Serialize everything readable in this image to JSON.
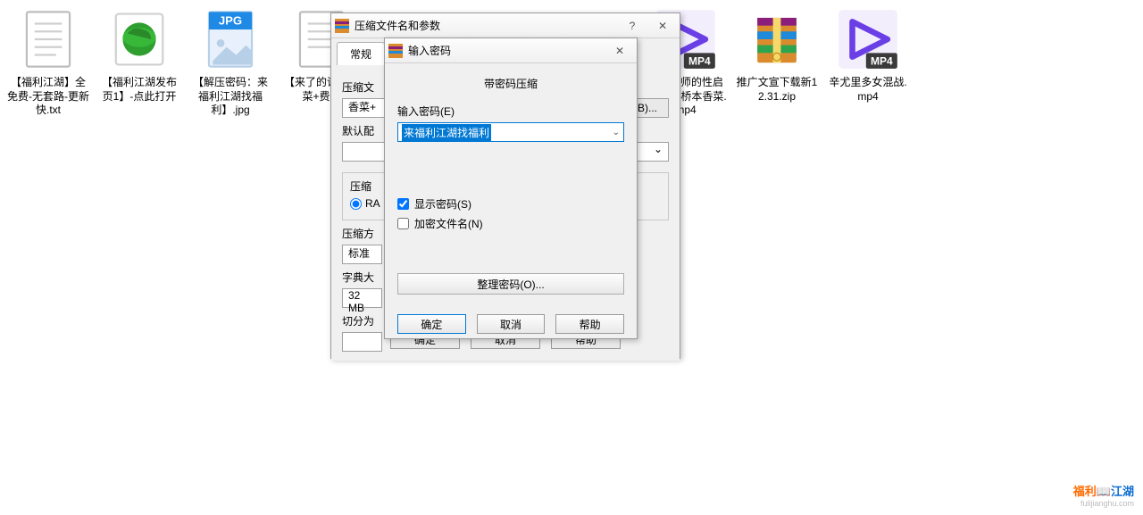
{
  "files": [
    {
      "name": "【福利江湖】全免费-无套路-更新快.txt",
      "type": "txt"
    },
    {
      "name": "【福利江湖发布页1】-点此打开",
      "type": "web"
    },
    {
      "name": "【解压密码：来福利江湖找福利】.jpg",
      "type": "jpg"
    },
    {
      "name": "【来了的论坛香菜+费！",
      "type": "txt"
    },
    {
      "name": "",
      "type": "blank"
    },
    {
      "name": "",
      "type": "blank"
    },
    {
      "name": "",
      "type": "blank"
    },
    {
      "name": "家教老师的性启性教育-桥本香菜.mp4",
      "type": "mp4"
    },
    {
      "name": "推广文宣下载新12.31.zip",
      "type": "zip"
    },
    {
      "name": "辛尤里多女混战.mp4",
      "type": "mp4"
    }
  ],
  "dialog_outer": {
    "title": "压缩文件名和参数",
    "tab_general": "常规",
    "lbl_archive_name": "压缩文",
    "archive_value": "香菜+",
    "browse": "(B)...",
    "lbl_default": "默认配",
    "group_format": "压缩",
    "radio_rar": "RA",
    "lbl_method": "压缩方",
    "method_value": "标准",
    "lbl_dict": "字典大",
    "dict_value": "32 MB",
    "lbl_split": "切分为",
    "btn_ok": "确定",
    "btn_cancel": "取消",
    "btn_help": "帮助"
  },
  "dialog_inner": {
    "title": "输入密码",
    "heading": "带密码压缩",
    "lbl_enter": "输入密码(E)",
    "password_value": "来福利江湖找福利",
    "cb_show": "显示密码(S)",
    "cb_encrypt": "加密文件名(N)",
    "btn_organize": "整理密码(O)...",
    "btn_ok": "确定",
    "btn_cancel": "取消",
    "btn_help": "帮助"
  },
  "watermark": {
    "line1a": "福利",
    "line1b": "江湖",
    "line2": "fulijianghu.com"
  }
}
